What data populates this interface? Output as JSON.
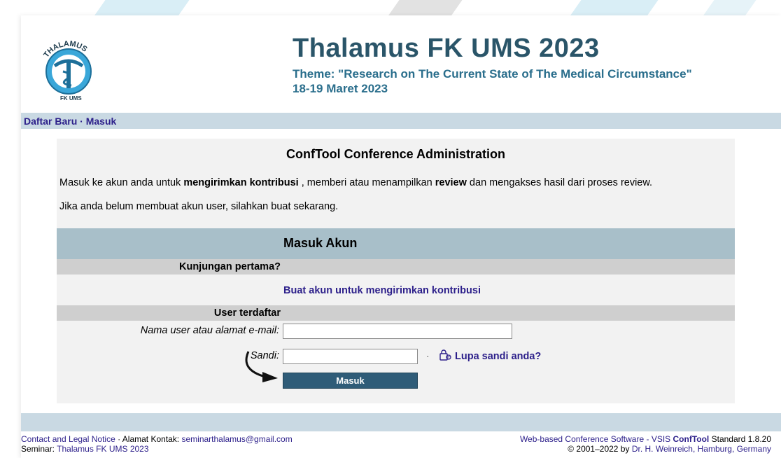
{
  "header": {
    "title": "Thalamus FK UMS 2023",
    "theme": "Theme: \"Research on The Current State of The Medical Circumstance\"",
    "date": "18-19 Maret 2023",
    "logo_text_top": "THALAMUS",
    "logo_text_bottom": "FK UMS"
  },
  "nav": {
    "register": "Daftar Baru",
    "separator": "·",
    "login": "Masuk"
  },
  "main": {
    "heading": "ConfTool Conference Administration",
    "intro_part1": "Masuk ke akun anda untuk ",
    "intro_bold1": "mengirimkan kontribusi",
    "intro_part2": " , memberi atau menampilkan ",
    "intro_bold2": "review",
    "intro_part3": " dan mengakses hasil dari proses review.",
    "no_account": "Jika anda belum membuat akun user, silahkan buat sekarang.",
    "login_heading": "Masuk Akun",
    "first_visit": "Kunjungan pertama?",
    "create_account": "Buat akun untuk mengirimkan kontribusi",
    "registered": "User terdaftar",
    "username_label": "Nama user atau alamat e-mail:",
    "username_value": "",
    "password_label": "Sandi:",
    "password_value": "",
    "forgot_password": "Lupa sandi anda?",
    "submit": "Masuk"
  },
  "footer": {
    "contact_link": "Contact and Legal Notice",
    "address_label": " · Alamat Kontak: ",
    "email": "seminarthalamus@gmail.com",
    "seminar_label": "Seminar: ",
    "seminar_link": "Thalamus FK UMS 2023",
    "software_link_pre": "Web-based Conference Software - VSIS ",
    "software_brand": "ConfTool",
    "software_edition": " Standard 1.8.20",
    "copyright_pre": "© 2001–2022 by ",
    "copyright_link": "Dr. H. Weinreich, Hamburg, Germany"
  },
  "colors": {
    "title": "#2a5569",
    "nav_bg": "#c9d9e3",
    "link": "#2c1f8a",
    "login_head_bg": "#a8bfc9",
    "button_bg": "#2f5c78"
  }
}
